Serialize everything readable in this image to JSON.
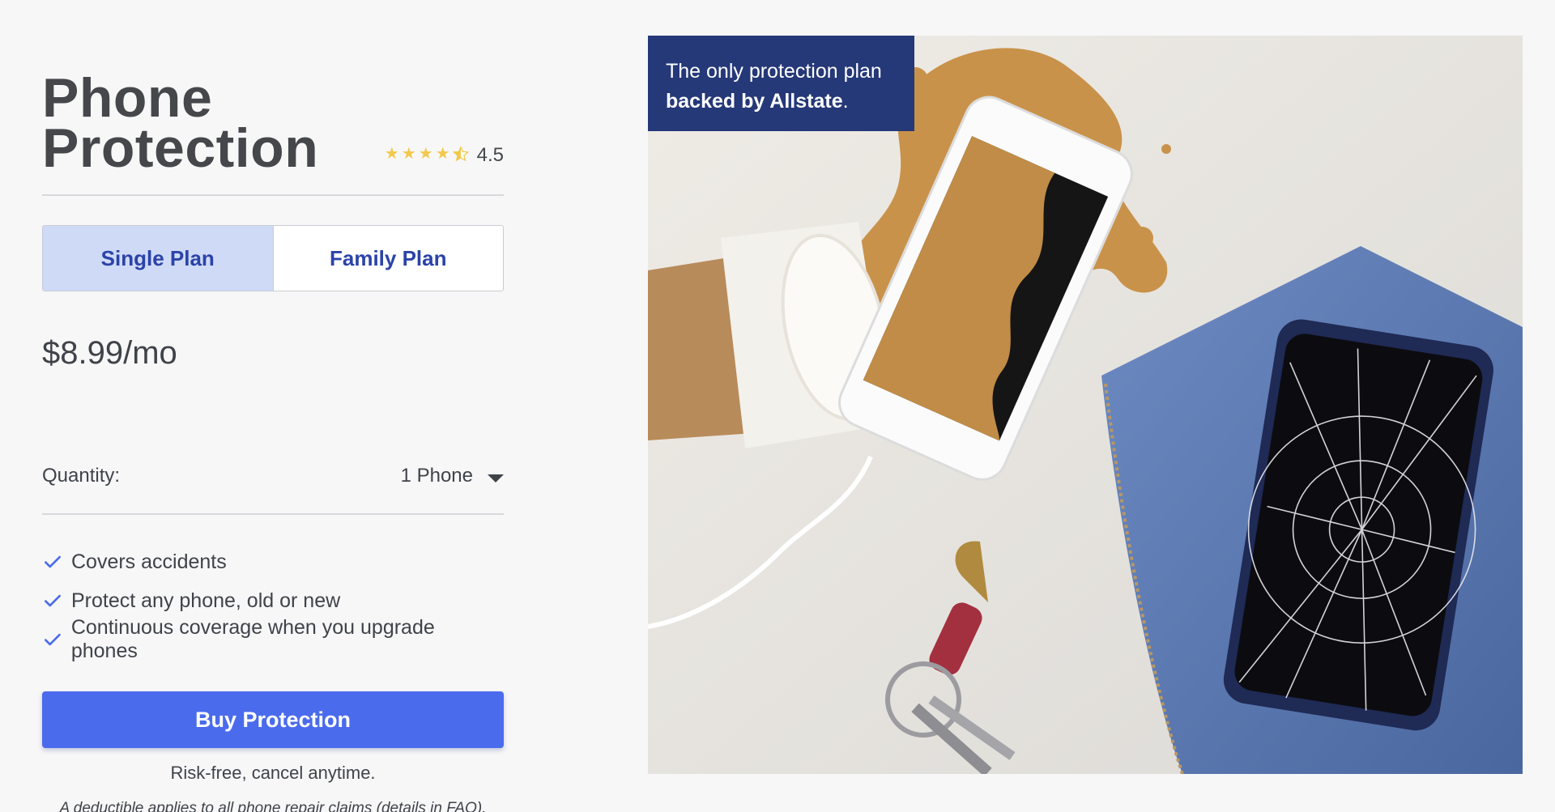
{
  "product": {
    "title_line1": "Phone",
    "title_line2": "Protection",
    "rating_value": "4.5",
    "rating": 4.5
  },
  "plans": {
    "single_label": "Single Plan",
    "family_label": "Family Plan",
    "selected": "single"
  },
  "price": "$8.99/mo",
  "quantity": {
    "label": "Quantity:",
    "selected": "1 Phone"
  },
  "features": [
    "Covers accidents",
    "Protect any phone, old or new",
    "Continuous coverage when you upgrade phones"
  ],
  "cta": {
    "buy_label": "Buy Protection",
    "risk_text": "Risk-free, cancel anytime.",
    "deductible_prefix": "A deductible applies to all phone repair claims (details in ",
    "faq_label": "FAQ",
    "deductible_suffix": ")."
  },
  "hero": {
    "badge_line1": "The only protection plan",
    "badge_bold": "backed by Allstate",
    "badge_suffix": "."
  },
  "colors": {
    "accent": "#4a6bec",
    "tab_active_bg": "#cfdaf6",
    "tab_text": "#2b43a8",
    "badge_bg": "#253878",
    "star": "#f2c94c"
  },
  "icons": {
    "feature": "checkmark-icon",
    "rating": "star-icon",
    "dropdown": "caret-down-icon"
  }
}
